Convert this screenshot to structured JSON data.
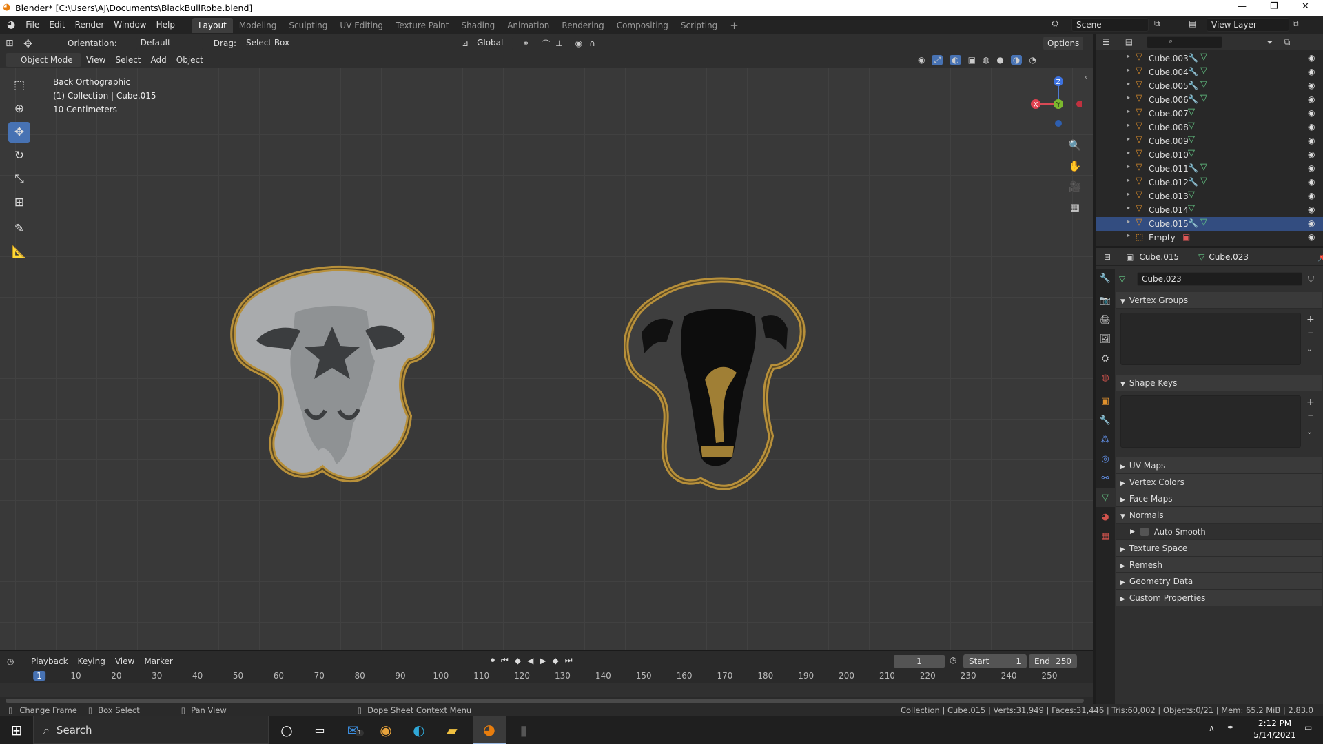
{
  "window": {
    "title": "Blender* [C:\\Users\\AJ\\Documents\\BlackBullRobe.blend]",
    "controls": [
      "—",
      "❐",
      "✕"
    ]
  },
  "menu": {
    "items": [
      "File",
      "Edit",
      "Render",
      "Window",
      "Help"
    ],
    "workspaces": [
      "Layout",
      "Modeling",
      "Sculpting",
      "UV Editing",
      "Texture Paint",
      "Shading",
      "Animation",
      "Rendering",
      "Compositing",
      "Scripting"
    ],
    "active_workspace": "Layout",
    "add_tab": "+",
    "scene": "Scene",
    "view_layer": "View Layer"
  },
  "tool_header": {
    "orientation_label": "Orientation:",
    "orientation_value": "Default",
    "drag_label": "Drag:",
    "drag_value": "Select Box",
    "transform_space": "Global",
    "options": "Options"
  },
  "viewport_header": {
    "mode": "Object Mode",
    "menus": [
      "View",
      "Select",
      "Add",
      "Object"
    ]
  },
  "viewport": {
    "overlay_lines": [
      "Back Orthographic",
      "(1) Collection | Cube.015",
      "10 Centimeters"
    ],
    "gizmo": {
      "z": "Z",
      "y": "Y",
      "x": "X"
    }
  },
  "timeline": {
    "menus": [
      "Playback",
      "Keying",
      "View",
      "Marker"
    ],
    "current_frame": "1",
    "start_label": "Start",
    "start_value": "1",
    "end_label": "End",
    "end_value": "250",
    "ticks": [
      "1",
      "10",
      "20",
      "30",
      "40",
      "50",
      "60",
      "70",
      "80",
      "90",
      "100",
      "110",
      "120",
      "130",
      "140",
      "150",
      "160",
      "170",
      "180",
      "190",
      "200",
      "210",
      "220",
      "230",
      "240",
      "250"
    ]
  },
  "outliner": {
    "search_placeholder": "",
    "items": [
      {
        "name": "Cube.003",
        "modifier": true
      },
      {
        "name": "Cube.004",
        "modifier": true
      },
      {
        "name": "Cube.005",
        "modifier": true
      },
      {
        "name": "Cube.006",
        "modifier": true
      },
      {
        "name": "Cube.007",
        "modifier": false
      },
      {
        "name": "Cube.008",
        "modifier": false
      },
      {
        "name": "Cube.009",
        "modifier": false
      },
      {
        "name": "Cube.010",
        "modifier": false
      },
      {
        "name": "Cube.011",
        "modifier": true
      },
      {
        "name": "Cube.012",
        "modifier": true
      },
      {
        "name": "Cube.013",
        "modifier": false
      },
      {
        "name": "Cube.014",
        "modifier": false
      },
      {
        "name": "Cube.015",
        "modifier": true
      },
      {
        "name": "Empty",
        "modifier": false
      }
    ],
    "selected": "Cube.015"
  },
  "properties": {
    "object_name": "Cube.015",
    "data_name": "Cube.023",
    "mesh_field": "Cube.023",
    "panels": {
      "vertex_groups": "Vertex Groups",
      "shape_keys": "Shape Keys",
      "uv_maps": "UV Maps",
      "vertex_colors": "Vertex Colors",
      "face_maps": "Face Maps",
      "normals": "Normals",
      "auto_smooth": "Auto Smooth",
      "texture_space": "Texture Space",
      "remesh": "Remesh",
      "geometry_data": "Geometry Data",
      "custom_properties": "Custom Properties"
    }
  },
  "status_bar": {
    "hint1": "Change Frame",
    "hint2": "Box Select",
    "hint3": "Pan View",
    "hint4": "Dope Sheet Context Menu",
    "stats": "Collection | Cube.015 | Verts:31,949 | Faces:31,446 | Tris:60,002 | Objects:0/21 | Mem: 65.2 MiB | 2.83.0"
  },
  "taskbar": {
    "search": "Search",
    "mail_badge": "1",
    "time": "2:12 PM",
    "date": "5/14/2021"
  },
  "colors": {
    "accent": "#4772b3",
    "outline_gold": "#b8903a",
    "skull_gray": "#a3a6a8",
    "mesh_orange": "#d98c2b",
    "data_green": "#66cc88"
  }
}
